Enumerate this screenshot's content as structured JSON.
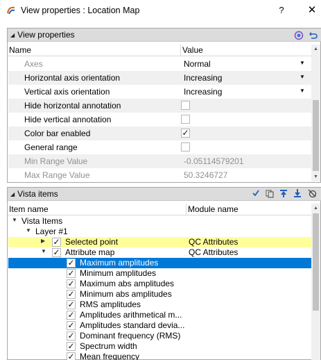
{
  "window": {
    "title": "View properties : Location Map",
    "help_label": "?",
    "close_label": "✕",
    "app_icon": "app-logo-icon"
  },
  "view_properties": {
    "title": "View properties",
    "collapse_glyph": "◢",
    "columns": {
      "name": "Name",
      "value": "Value"
    },
    "rows": [
      {
        "name": "Axes",
        "value": "Normal",
        "kind": "dropdown",
        "disabled": true
      },
      {
        "name": "Horizontal axis orientation",
        "value": "Increasing",
        "kind": "dropdown",
        "disabled": false
      },
      {
        "name": "Vertical axis orientation",
        "value": "Increasing",
        "kind": "dropdown",
        "disabled": false
      },
      {
        "name": "Hide horizontal annotation",
        "value": "",
        "kind": "checkbox",
        "checked": false,
        "disabled": false
      },
      {
        "name": "Hide vertical annotation",
        "value": "",
        "kind": "checkbox",
        "checked": false,
        "disabled": false
      },
      {
        "name": "Color bar enabled",
        "value": "",
        "kind": "checkbox",
        "checked": true,
        "disabled": false
      },
      {
        "name": "General range",
        "value": "",
        "kind": "checkbox",
        "checked": false,
        "disabled": false
      },
      {
        "name": "Min Range Value",
        "value": "-0.05114579201",
        "kind": "text",
        "disabled": true
      },
      {
        "name": "Max Range Value",
        "value": "50.3246727",
        "kind": "text",
        "disabled": true
      }
    ]
  },
  "vista_items": {
    "title": "Vista items",
    "collapse_glyph": "◢",
    "columns": {
      "name": "Item name",
      "module": "Module name"
    },
    "tree": [
      {
        "label": "Vista Items",
        "module": "",
        "level": 0,
        "twisty": "▼",
        "checkbox": false
      },
      {
        "label": "Layer  #1",
        "module": "",
        "level": 1,
        "twisty": "▼",
        "checkbox": false
      },
      {
        "label": "Selected point",
        "module": "QC Attributes",
        "level": 2,
        "twisty": "▶",
        "checkbox": true,
        "checked": true,
        "highlight": "yellow"
      },
      {
        "label": "Attribute map",
        "module": "QC Attributes",
        "level": 2,
        "twisty": "▼",
        "checkbox": true,
        "checked": true
      },
      {
        "label": "Maximum amplitudes",
        "module": "",
        "level": 3,
        "twisty": "",
        "checkbox": true,
        "checked": true,
        "highlight": "blue"
      },
      {
        "label": "Minimum amplitudes",
        "module": "",
        "level": 3,
        "twisty": "",
        "checkbox": true,
        "checked": true
      },
      {
        "label": "Maximum abs amplitudes",
        "module": "",
        "level": 3,
        "twisty": "",
        "checkbox": true,
        "checked": true
      },
      {
        "label": "Minimum abs amplitudes",
        "module": "",
        "level": 3,
        "twisty": "",
        "checkbox": true,
        "checked": true
      },
      {
        "label": "RMS amplitudes",
        "module": "",
        "level": 3,
        "twisty": "",
        "checkbox": true,
        "checked": true
      },
      {
        "label": "Amplitudes arithmetical m...",
        "module": "",
        "level": 3,
        "twisty": "",
        "checkbox": true,
        "checked": true
      },
      {
        "label": "Amplitudes standard devia...",
        "module": "",
        "level": 3,
        "twisty": "",
        "checkbox": true,
        "checked": true
      },
      {
        "label": "Dominant frequency (RMS)",
        "module": "",
        "level": 3,
        "twisty": "",
        "checkbox": true,
        "checked": true
      },
      {
        "label": "Spectrum width",
        "module": "",
        "level": 3,
        "twisty": "",
        "checkbox": true,
        "checked": true
      },
      {
        "label": "Mean frequency",
        "module": "",
        "level": 3,
        "twisty": "",
        "checkbox": true,
        "checked": true
      }
    ]
  },
  "icons": {
    "view_props_settings": "settings-circle-icon",
    "view_props_reset": "undo-arrow-icon",
    "vista_check": "check-all-icon",
    "vista_copy": "copy-layers-icon",
    "vista_move_up": "move-up-icon",
    "vista_move_down": "move-down-icon",
    "vista_disable": "disable-icon"
  },
  "colors": {
    "selection": "#0078d7",
    "highlight_yellow": "#ffff9a",
    "header_bg": "#dcdcdc",
    "icon_blue": "#1f5fbf"
  }
}
